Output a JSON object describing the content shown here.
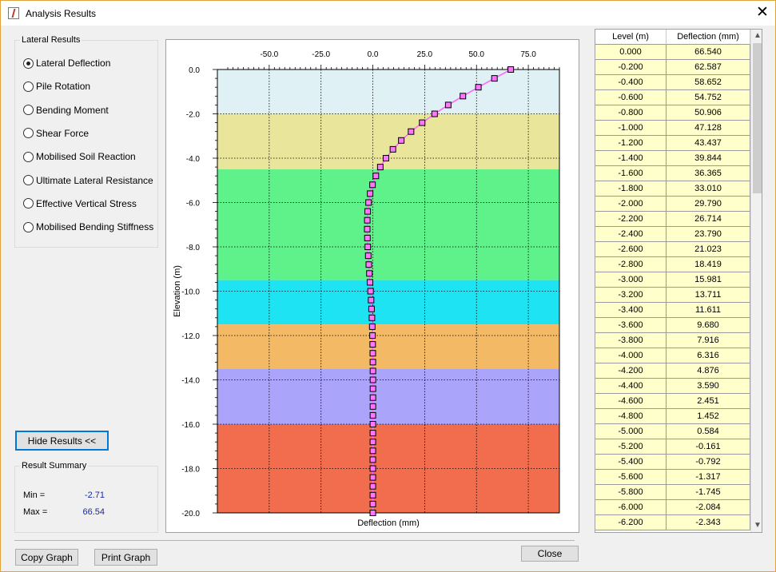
{
  "window": {
    "title": "Analysis Results",
    "close_glyph": "✕"
  },
  "lateral_results": {
    "legend": "Lateral Results",
    "options": [
      {
        "label": "Lateral Deflection",
        "selected": true
      },
      {
        "label": "Pile Rotation",
        "selected": false
      },
      {
        "label": "Bending Moment",
        "selected": false
      },
      {
        "label": "Shear Force",
        "selected": false
      },
      {
        "label": "Mobilised Soil Reaction",
        "selected": false
      },
      {
        "label": "Ultimate Lateral Resistance",
        "selected": false
      },
      {
        "label": "Effective Vertical Stress",
        "selected": false
      },
      {
        "label": "Mobilised Bending Stiffness",
        "selected": false
      }
    ]
  },
  "buttons": {
    "hide_results": "Hide Results <<",
    "copy_graph": "Copy Graph",
    "print_graph": "Print Graph",
    "close": "Close"
  },
  "summary": {
    "legend": "Result Summary",
    "min_label": "Min =",
    "min_value": "-2.71",
    "max_label": "Max =",
    "max_value": "66.54"
  },
  "chart_data": {
    "type": "line",
    "xlabel": "Deflection (mm)",
    "ylabel": "Elevation (m)",
    "xlim": [
      -75,
      90
    ],
    "ylim": [
      -20,
      0
    ],
    "x_tick_labels": [
      "-50.0",
      "-25.0",
      "0.0",
      "25.0",
      "50.0",
      "75.0"
    ],
    "x_ticks": [
      -50,
      -25,
      0,
      25,
      50,
      75
    ],
    "y_tick_labels": [
      "0.0",
      "-2.0",
      "-4.0",
      "-6.0",
      "-8.0",
      "-10.0",
      "-12.0",
      "-14.0",
      "-16.0",
      "-18.0",
      "-20.0"
    ],
    "y_ticks": [
      0,
      -2,
      -4,
      -6,
      -8,
      -10,
      -12,
      -14,
      -16,
      -18,
      -20
    ],
    "grid": true,
    "layers": [
      {
        "top": 0,
        "bottom": -2.0,
        "color": "#dff1f5"
      },
      {
        "top": -2.0,
        "bottom": -4.5,
        "color": "#e9e59a"
      },
      {
        "top": -4.5,
        "bottom": -9.5,
        "color": "#60f28a"
      },
      {
        "top": -9.5,
        "bottom": -11.5,
        "color": "#1ee3f2"
      },
      {
        "top": -11.5,
        "bottom": -13.5,
        "color": "#f3b965"
      },
      {
        "top": -13.5,
        "bottom": -16.0,
        "color": "#aba4fb"
      },
      {
        "top": -16.0,
        "bottom": -20.0,
        "color": "#f26d4d"
      }
    ],
    "series": [
      {
        "line_color": "#ff66ff",
        "marker_color": "#ff77ff",
        "points": [
          [
            66.54,
            0.0
          ],
          [
            58.65,
            -0.4
          ],
          [
            50.91,
            -0.8
          ],
          [
            43.44,
            -1.2
          ],
          [
            36.37,
            -1.6
          ],
          [
            29.79,
            -2.0
          ],
          [
            23.79,
            -2.4
          ],
          [
            18.42,
            -2.8
          ],
          [
            13.71,
            -3.2
          ],
          [
            9.68,
            -3.6
          ],
          [
            6.32,
            -4.0
          ],
          [
            3.59,
            -4.4
          ],
          [
            1.45,
            -4.8
          ],
          [
            -0.16,
            -5.2
          ],
          [
            -1.32,
            -5.6
          ],
          [
            -2.08,
            -6.0
          ],
          [
            -2.5,
            -6.4
          ],
          [
            -2.68,
            -6.8
          ],
          [
            -2.71,
            -7.2
          ],
          [
            -2.62,
            -7.6
          ],
          [
            -2.45,
            -8.0
          ],
          [
            -2.22,
            -8.4
          ],
          [
            -1.95,
            -8.8
          ],
          [
            -1.67,
            -9.2
          ],
          [
            -1.38,
            -9.6
          ],
          [
            -1.1,
            -10.0
          ],
          [
            -0.85,
            -10.4
          ],
          [
            -0.63,
            -10.8
          ],
          [
            -0.44,
            -11.2
          ],
          [
            -0.29,
            -11.6
          ],
          [
            -0.17,
            -12.0
          ],
          [
            -0.08,
            -12.4
          ],
          [
            -0.02,
            -12.8
          ],
          [
            0.02,
            -13.2
          ],
          [
            0.04,
            -13.6
          ],
          [
            0.05,
            -14.0
          ],
          [
            0.05,
            -14.4
          ],
          [
            0.05,
            -14.8
          ],
          [
            0.04,
            -15.2
          ],
          [
            0.03,
            -15.6
          ],
          [
            0.02,
            -16.0
          ],
          [
            0.02,
            -16.4
          ],
          [
            0.01,
            -16.8
          ],
          [
            0.01,
            -17.2
          ],
          [
            0.0,
            -17.6
          ],
          [
            0.0,
            -18.0
          ],
          [
            0.0,
            -18.4
          ],
          [
            0.0,
            -18.8
          ],
          [
            0.0,
            -19.2
          ],
          [
            0.0,
            -19.6
          ],
          [
            0.0,
            -20.0
          ]
        ]
      }
    ]
  },
  "results_table": {
    "headers": [
      "Level (m)",
      "Deflection (mm)"
    ],
    "rows": [
      [
        "0.000",
        "66.540"
      ],
      [
        "-0.200",
        "62.587"
      ],
      [
        "-0.400",
        "58.652"
      ],
      [
        "-0.600",
        "54.752"
      ],
      [
        "-0.800",
        "50.906"
      ],
      [
        "-1.000",
        "47.128"
      ],
      [
        "-1.200",
        "43.437"
      ],
      [
        "-1.400",
        "39.844"
      ],
      [
        "-1.600",
        "36.365"
      ],
      [
        "-1.800",
        "33.010"
      ],
      [
        "-2.000",
        "29.790"
      ],
      [
        "-2.200",
        "26.714"
      ],
      [
        "-2.400",
        "23.790"
      ],
      [
        "-2.600",
        "21.023"
      ],
      [
        "-2.800",
        "18.419"
      ],
      [
        "-3.000",
        "15.981"
      ],
      [
        "-3.200",
        "13.711"
      ],
      [
        "-3.400",
        "11.611"
      ],
      [
        "-3.600",
        "9.680"
      ],
      [
        "-3.800",
        "7.916"
      ],
      [
        "-4.000",
        "6.316"
      ],
      [
        "-4.200",
        "4.876"
      ],
      [
        "-4.400",
        "3.590"
      ],
      [
        "-4.600",
        "2.451"
      ],
      [
        "-4.800",
        "1.452"
      ],
      [
        "-5.000",
        "0.584"
      ],
      [
        "-5.200",
        "-0.161"
      ],
      [
        "-5.400",
        "-0.792"
      ],
      [
        "-5.600",
        "-1.317"
      ],
      [
        "-5.800",
        "-1.745"
      ],
      [
        "-6.000",
        "-2.084"
      ],
      [
        "-6.200",
        "-2.343"
      ]
    ]
  },
  "icons": {
    "scroll_up": "▲",
    "scroll_down": "▼"
  }
}
